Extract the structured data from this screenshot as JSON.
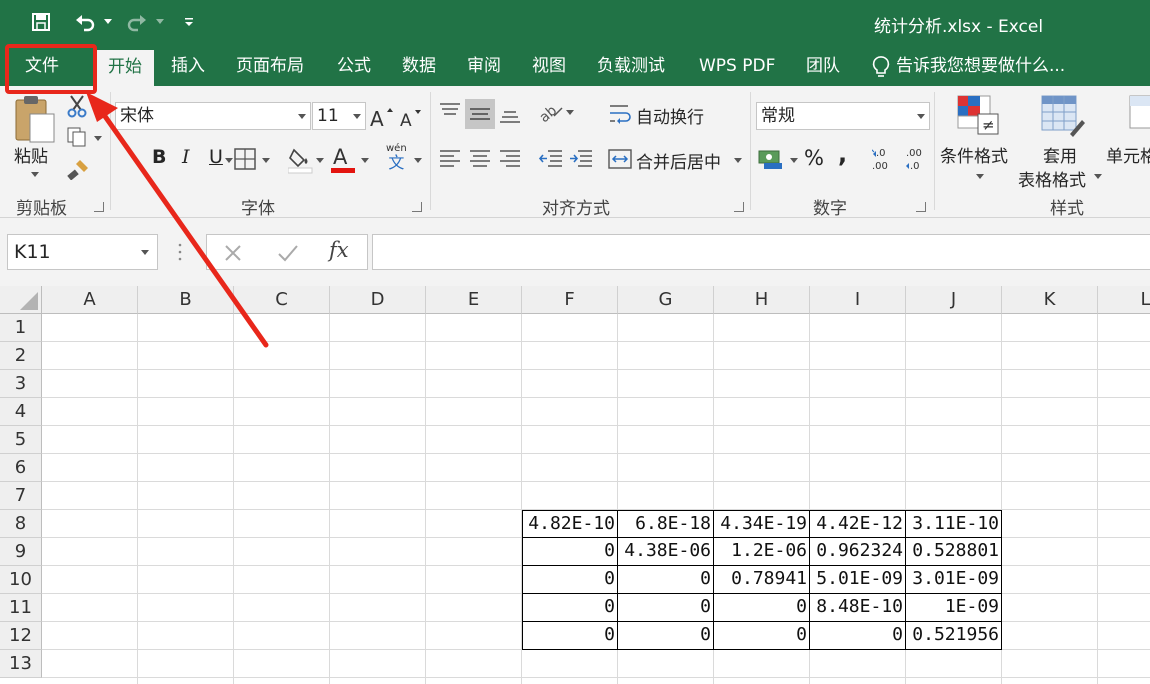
{
  "app": {
    "window_title": "统计分析.xlsx - Excel"
  },
  "quick_access": {
    "icons": [
      "save-icon",
      "undo-icon",
      "redo-icon",
      "customize-icon"
    ]
  },
  "tabs": [
    {
      "label": "文件"
    },
    {
      "label": "开始"
    },
    {
      "label": "插入"
    },
    {
      "label": "页面布局"
    },
    {
      "label": "公式"
    },
    {
      "label": "数据"
    },
    {
      "label": "审阅"
    },
    {
      "label": "视图"
    },
    {
      "label": "负载测试"
    },
    {
      "label": "WPS PDF"
    },
    {
      "label": "团队"
    }
  ],
  "tell_me": {
    "text": "告诉我您想要做什么..."
  },
  "ribbon": {
    "clipboard": {
      "label": "剪贴板",
      "paste": "粘贴"
    },
    "font": {
      "label": "字体",
      "font_name": "宋体",
      "font_size": "11",
      "font_color": "#e3140f",
      "phonetic": "wén",
      "phonetic_char": "文",
      "bold": "B",
      "italic": "I",
      "underline": "U"
    },
    "alignment": {
      "label": "对齐方式",
      "wrap_text": "自动换行",
      "merge_center": "合并后居中"
    },
    "number": {
      "label": "数字",
      "format": "常规",
      "percent": "%",
      "comma": ","
    },
    "styles": {
      "label": "样式",
      "conditional": "条件格式",
      "table_format_1": "套用",
      "table_format_2": "表格格式",
      "cell_styles": "单元格"
    }
  },
  "formula_bar": {
    "name_box": "K11",
    "fx": "fx",
    "formula": ""
  },
  "sheet": {
    "columns": [
      "A",
      "B",
      "C",
      "D",
      "E",
      "F",
      "G",
      "H",
      "I",
      "J",
      "K",
      "L"
    ],
    "rows": [
      "1",
      "2",
      "3",
      "4",
      "5",
      "6",
      "7",
      "8",
      "9",
      "10",
      "11",
      "12",
      "13"
    ],
    "data": [
      [
        "4.82E-10",
        "6.8E-18",
        "4.34E-19",
        "4.42E-12",
        "3.11E-10"
      ],
      [
        "0",
        "4.38E-06",
        "1.2E-06",
        "0.962324",
        "0.528801"
      ],
      [
        "0",
        "0",
        "0.78941",
        "5.01E-09",
        "3.01E-09"
      ],
      [
        "0",
        "0",
        "0",
        "8.48E-10",
        "1E-09"
      ],
      [
        "0",
        "0",
        "0",
        "0",
        "0.521956"
      ]
    ]
  },
  "colors": {
    "brand": "#217346",
    "annotation": "#e8271b"
  }
}
